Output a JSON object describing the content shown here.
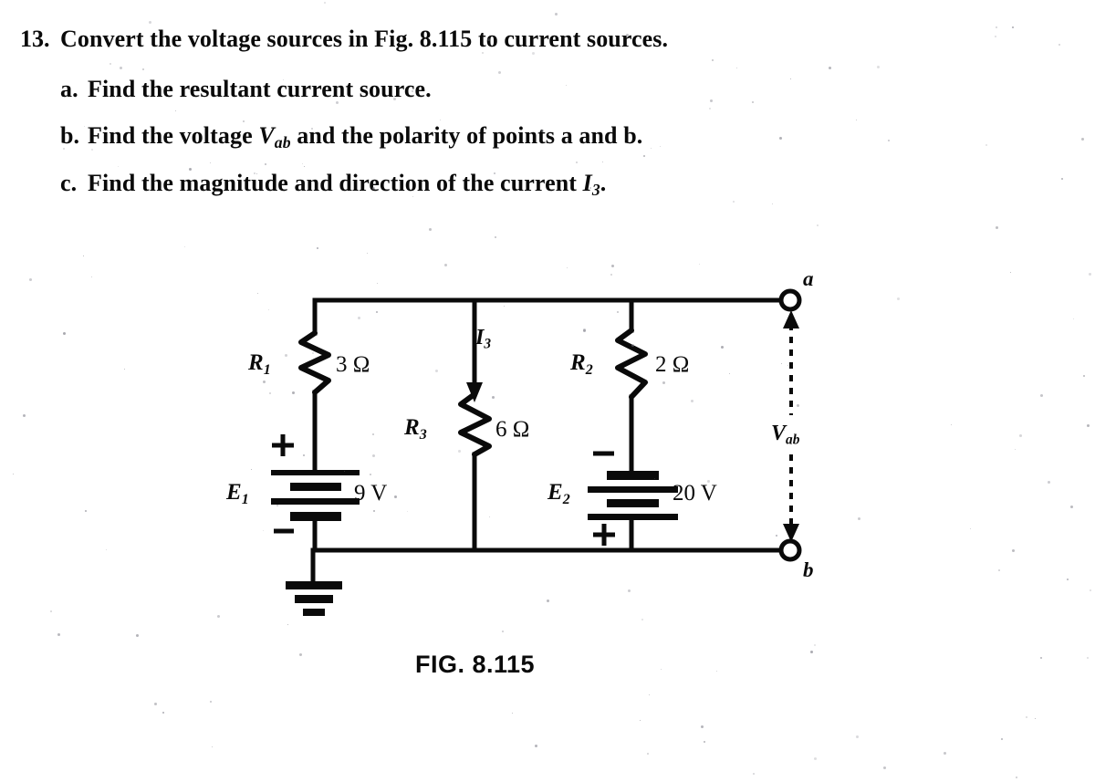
{
  "problem": {
    "number": "13.",
    "stem": "Convert the voltage sources in Fig. 8.115 to current sources.",
    "parts": [
      {
        "marker": "a.",
        "text": "Find the resultant current source."
      },
      {
        "marker": "b.",
        "text_pre": "Find the voltage ",
        "symbol": "V",
        "symbol_sub": "ab",
        "text_post": " and the polarity of points a and b."
      },
      {
        "marker": "c.",
        "text_pre": "Find the magnitude and direction of the current ",
        "symbol": "I",
        "symbol_sub": "3",
        "text_post": "."
      }
    ]
  },
  "figure": {
    "caption": "FIG. 8.115",
    "terminals": [
      {
        "name": "a",
        "label": "a"
      },
      {
        "name": "b",
        "label": "b"
      }
    ],
    "voltage_label": {
      "symbol": "V",
      "sub": "ab"
    },
    "current_label": {
      "symbol": "I",
      "sub": "3"
    },
    "components": [
      {
        "id": "R1",
        "type": "resistor",
        "symbol": "R",
        "sub": "1",
        "value": "3 Ω"
      },
      {
        "id": "R2",
        "type": "resistor",
        "symbol": "R",
        "sub": "2",
        "value": "2 Ω"
      },
      {
        "id": "R3",
        "type": "resistor",
        "symbol": "R",
        "sub": "3",
        "value": "6 Ω"
      },
      {
        "id": "E1",
        "type": "battery",
        "symbol": "E",
        "sub": "1",
        "value": "9 V",
        "plus_position": "top",
        "minus_position": "bottom"
      },
      {
        "id": "E2",
        "type": "battery",
        "symbol": "E",
        "sub": "2",
        "value": "20 V",
        "plus_position": "bottom",
        "minus_position": "top"
      }
    ],
    "ground": {
      "name": "earth-ground",
      "at": "E1 bottom node"
    },
    "polarity_marks": {
      "E1_plus": "+",
      "E1_minus": "−",
      "E2_plus": "+",
      "E2_minus": "−"
    }
  },
  "colors": {
    "ink": "#0a0a0a",
    "paper": "#ffffff",
    "speckle": "#8c8c94"
  }
}
